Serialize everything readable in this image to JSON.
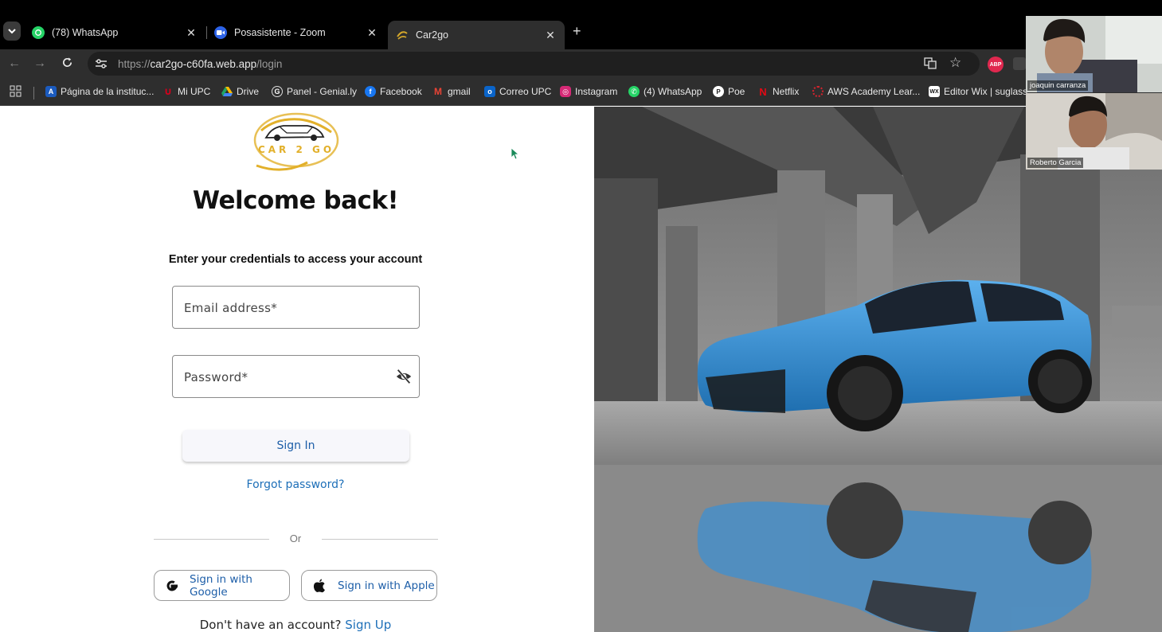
{
  "browser": {
    "tabs": [
      {
        "title": "(78) WhatsApp",
        "icon": "whatsapp-icon"
      },
      {
        "title": "Posasistente - Zoom",
        "icon": "zoom-icon"
      },
      {
        "title": "Car2go",
        "icon": "car2go-icon",
        "active": true
      }
    ],
    "address": {
      "scheme": "https://",
      "host": "car2go-c60fa.web.app",
      "path": "/login"
    },
    "extension_badge": "ABP",
    "bookmarks": [
      {
        "label": "Página de la instituc...",
        "icon": "institution-icon"
      },
      {
        "label": "Mi UPC",
        "icon": "upc-icon"
      },
      {
        "label": "Drive",
        "icon": "drive-icon"
      },
      {
        "label": "Panel - Genial.ly",
        "icon": "genially-icon"
      },
      {
        "label": "Facebook",
        "icon": "facebook-icon"
      },
      {
        "label": "gmail",
        "icon": "gmail-icon"
      },
      {
        "label": "Correo UPC",
        "icon": "outlook-icon"
      },
      {
        "label": "Instagram",
        "icon": "instagram-icon"
      },
      {
        "label": "(4) WhatsApp",
        "icon": "whatsapp-icon"
      },
      {
        "label": "Poe",
        "icon": "poe-icon"
      },
      {
        "label": "Netflix",
        "icon": "netflix-icon"
      },
      {
        "label": "AWS Academy Lear...",
        "icon": "aws-icon"
      },
      {
        "label": "Editor Wix | suglass...",
        "icon": "wix-icon"
      }
    ]
  },
  "login": {
    "logo_text": "CAR 2 GO",
    "heading": "Welcome back!",
    "subtitle": "Enter your credentials to access your account",
    "email_placeholder": "Email address*",
    "password_placeholder": "Password*",
    "sign_in": "Sign In",
    "forgot": "Forgot password?",
    "or": "Or",
    "google": "Sign in with Google",
    "apple": "Sign in with Apple",
    "no_account": "Don't have an account?",
    "sign_up": "Sign Up"
  },
  "zoom": {
    "participants": [
      {
        "name": "joaquin carranza"
      },
      {
        "name": "Roberto Garcia"
      }
    ]
  },
  "colors": {
    "link": "#1d6fb8",
    "logo_gold": "#e2b02a",
    "car_blue": "#2f8fd6"
  }
}
